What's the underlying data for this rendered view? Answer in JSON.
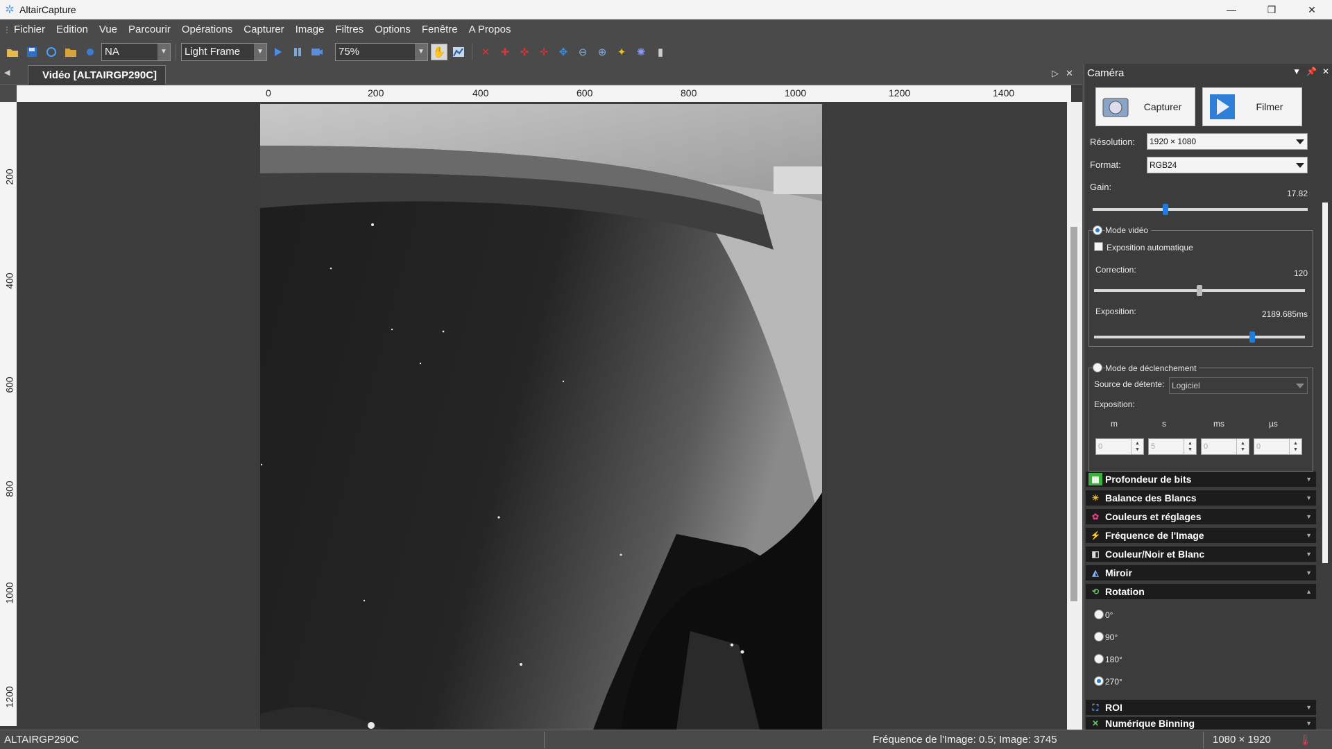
{
  "window": {
    "title": "AltairCapture"
  },
  "menu": [
    "Fichier",
    "Edition",
    "Vue",
    "Parcourir",
    "Opérations",
    "Capturer",
    "Image",
    "Filtres",
    "Options",
    "Fenêtre",
    "A Propos"
  ],
  "toolbar": {
    "na_value": "NA",
    "frame_type": "Light Frame",
    "zoom": "75%"
  },
  "document": {
    "tab_title": "Vidéo [ALTAIRGP290C]",
    "ruler_top": [
      "0",
      "200",
      "400",
      "600",
      "800",
      "1000",
      "1200",
      "1400"
    ],
    "ruler_left": [
      "200",
      "400",
      "600",
      "800",
      "1000",
      "1200"
    ]
  },
  "camera_panel": {
    "title": "Caméra",
    "capture_label": "Capturer",
    "record_label": "Filmer",
    "resolution_label": "Résolution:",
    "resolution_value": "1920 × 1080",
    "format_label": "Format:",
    "format_value": "RGB24",
    "gain_label": "Gain:",
    "gain_value": "17.82",
    "gain_level": 0.34,
    "video_mode_label": "Mode vidéo",
    "auto_exposure_label": "Exposition automatique",
    "correction_label": "Correction:",
    "correction_value": "120",
    "correction_level": 0.5,
    "exposure_label": "Exposition:",
    "exposure_value": "2189.685ms",
    "exposure_level": 0.75,
    "trigger_mode_label": "Mode de déclenchement",
    "trigger_source_label": "Source de détente:",
    "trigger_source_value": "Logiciel",
    "trigger_exposure_label": "Exposition:",
    "time_units": [
      "m",
      "s",
      "ms",
      "µs"
    ],
    "time_values": [
      "0",
      "5",
      "0",
      "0"
    ],
    "sections": [
      "Profondeur de bits",
      "Balance des Blancs",
      "Couleurs et réglages",
      "Fréquence de l'Image",
      "Couleur/Noir et Blanc",
      "Miroir",
      "Rotation"
    ],
    "rotation_options": [
      "0°",
      "90°",
      "180°",
      "270°"
    ],
    "rotation_selected": "270°",
    "sections_after": [
      "ROI",
      "Numérique Binning"
    ]
  },
  "statusbar": {
    "camera": "ALTAIRGP290C",
    "frame_info": "Fréquence de l'Image: 0.5; Image: 3745",
    "image_size": "1080 × 1920"
  },
  "colors": {
    "accent": "#1e7ee0",
    "panel": "#3c3c3c",
    "chrome": "#4a4a4a"
  }
}
